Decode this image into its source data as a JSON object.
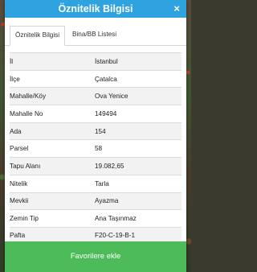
{
  "dialog": {
    "title": "Öznitelik Bilgisi",
    "close_glyph": "×"
  },
  "tabs": [
    {
      "label": "Öznitelik Bilgisi",
      "active": true
    },
    {
      "label": "Bina/BB Listesi",
      "active": false
    }
  ],
  "rows": [
    {
      "label": "İl",
      "value": "İstanbul"
    },
    {
      "label": "İlçe",
      "value": "Çatalca"
    },
    {
      "label": "Mahalle/Köy",
      "value": "Ova Yenice"
    },
    {
      "label": "Mahalle No",
      "value": "149494"
    },
    {
      "label": "Ada",
      "value": "154"
    },
    {
      "label": "Parsel",
      "value": "58"
    },
    {
      "label": "Tapu Alanı",
      "value": "19.082,65"
    },
    {
      "label": "Nitelik",
      "value": "Tarla"
    },
    {
      "label": "Mevkii",
      "value": "Ayazma"
    },
    {
      "label": "Zemin Tip",
      "value": "Ana Taşınmaz"
    },
    {
      "label": "Pafta",
      "value": "F20-C-19-B-1"
    }
  ],
  "footer": {
    "button_label": "Favorilere ekle"
  },
  "colors": {
    "title_bar": "#2ea3e0",
    "footer_button": "#4dbb5a"
  }
}
